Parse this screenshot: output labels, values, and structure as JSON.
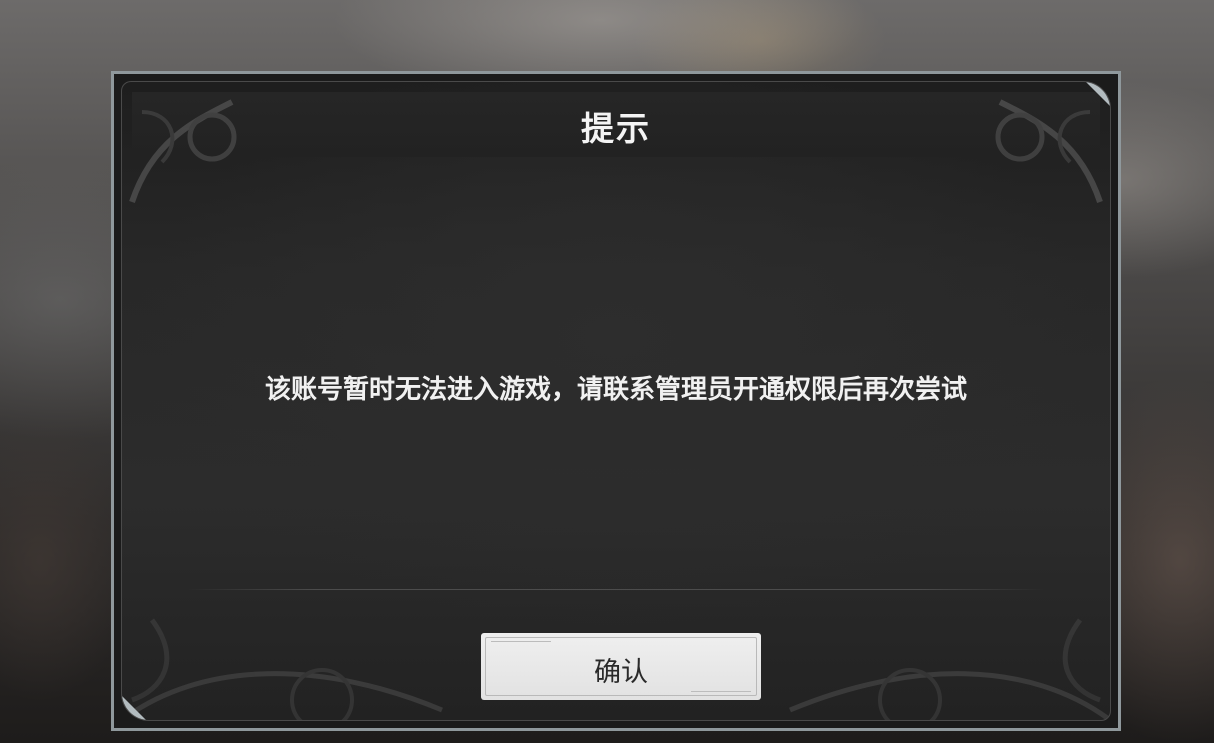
{
  "dialog": {
    "title": "提示",
    "message": "该账号暂时无法进入游戏，请联系管理员开通权限后再次尝试",
    "confirm_label": "确认"
  }
}
